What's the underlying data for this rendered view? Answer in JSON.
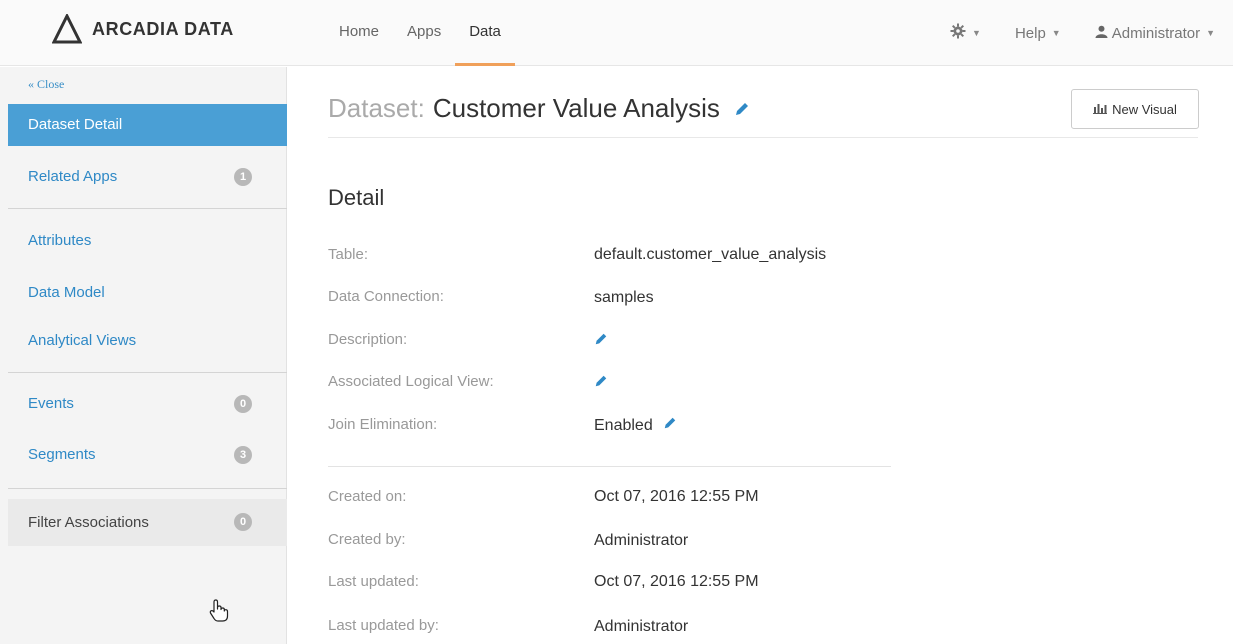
{
  "brand": {
    "name": "ARCADIA DATA"
  },
  "nav": {
    "items": [
      {
        "label": "Home"
      },
      {
        "label": "Apps"
      },
      {
        "label": "Data"
      }
    ]
  },
  "right_nav": {
    "help_label": "Help",
    "user_label": "Administrator",
    "settings_icon": "gear-icon",
    "user_icon": "user-icon"
  },
  "sidebar": {
    "close_label": "« Close",
    "items": [
      {
        "label": "Dataset Detail"
      },
      {
        "label": "Related Apps",
        "badge": "1"
      },
      {
        "label": "Attributes"
      },
      {
        "label": "Data Model"
      },
      {
        "label": "Analytical Views"
      },
      {
        "label": "Events",
        "badge": "0"
      },
      {
        "label": "Segments",
        "badge": "3"
      },
      {
        "label": "Filter Associations",
        "badge": "0"
      }
    ]
  },
  "main": {
    "title_prefix": "Dataset:",
    "title": "Customer Value Analysis",
    "new_visual_label": "New Visual",
    "section_title": "Detail",
    "details": [
      {
        "label": "Table:",
        "value": "default.customer_value_analysis"
      },
      {
        "label": "Data Connection:",
        "value": "samples"
      },
      {
        "label": "Description:",
        "value": ""
      },
      {
        "label": "Associated Logical View:",
        "value": ""
      },
      {
        "label": "Join Elimination:",
        "value": "Enabled"
      }
    ],
    "meta": [
      {
        "label": "Created on:",
        "value": "Oct 07, 2016 12:55 PM"
      },
      {
        "label": "Created by:",
        "value": "Administrator"
      },
      {
        "label": "Last updated:",
        "value": "Oct 07, 2016 12:55 PM"
      },
      {
        "label": "Last updated by:",
        "value": "Administrator"
      }
    ]
  },
  "colors": {
    "accent": "#4a9fd5",
    "link": "#2f89c6",
    "nav_active_underline": "#f0a05a"
  }
}
